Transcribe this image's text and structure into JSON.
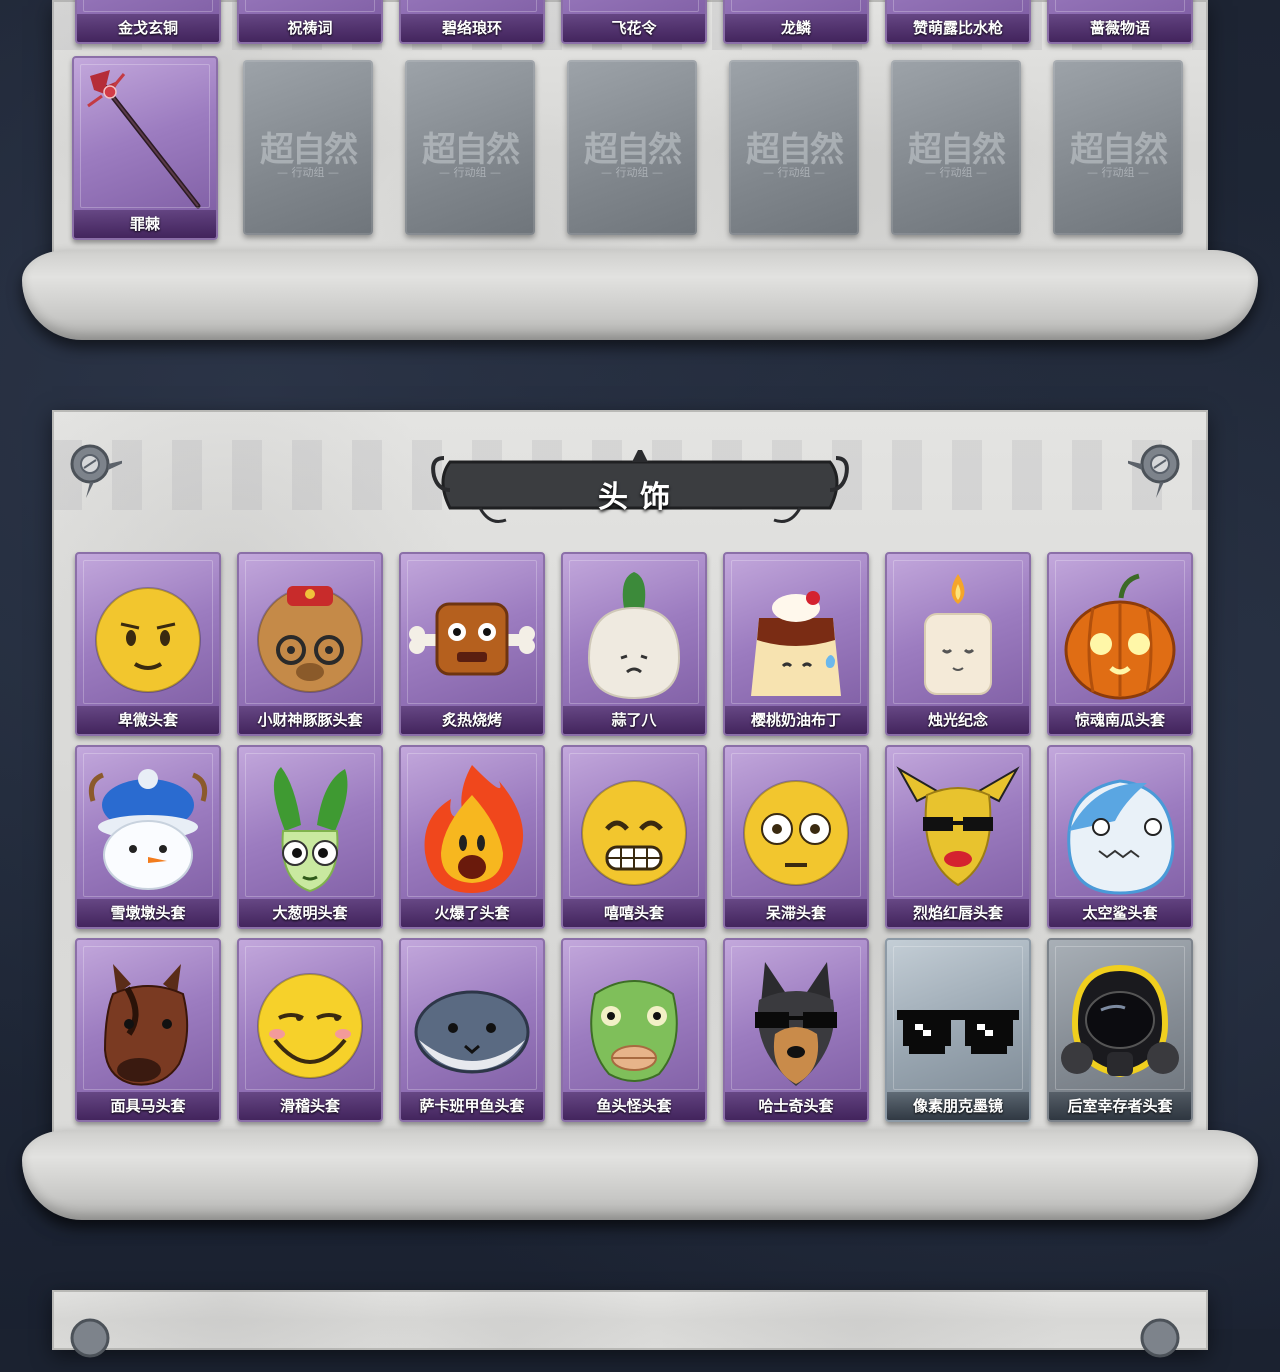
{
  "top_section": {
    "row1_labels": [
      "金戈玄铜",
      "祝祷词",
      "碧络琅环",
      "飞花令",
      "龙鳞",
      "赞萌露比水枪",
      "蔷薇物语"
    ],
    "first_item": "罪棘",
    "placeholder_logo": "超自然",
    "placeholder_sub": "行动组"
  },
  "head_section": {
    "title": "头饰",
    "items": [
      {
        "label": "卑微头套",
        "icon": "sad-smiley-head-icon",
        "rarity": "purple"
      },
      {
        "label": "小财神豚豚头套",
        "icon": "capybara-head-icon",
        "rarity": "purple"
      },
      {
        "label": "炙热烧烤",
        "icon": "meat-bone-head-icon",
        "rarity": "purple"
      },
      {
        "label": "蒜了八",
        "icon": "garlic-head-icon",
        "rarity": "purple"
      },
      {
        "label": "樱桃奶油布丁",
        "icon": "pudding-head-icon",
        "rarity": "purple"
      },
      {
        "label": "烛光纪念",
        "icon": "candle-head-icon",
        "rarity": "purple"
      },
      {
        "label": "惊魂南瓜头套",
        "icon": "pumpkin-head-icon",
        "rarity": "purple"
      },
      {
        "label": "雪墩墩头套",
        "icon": "snowman-head-icon",
        "rarity": "purple"
      },
      {
        "label": "大葱明头套",
        "icon": "scallion-head-icon",
        "rarity": "purple"
      },
      {
        "label": "火爆了头套",
        "icon": "fire-head-icon",
        "rarity": "purple"
      },
      {
        "label": "嘻嘻头套",
        "icon": "grin-smiley-head-icon",
        "rarity": "purple"
      },
      {
        "label": "呆滞头套",
        "icon": "blank-stare-head-icon",
        "rarity": "purple"
      },
      {
        "label": "烈焰红唇头套",
        "icon": "yellow-mask-head-icon",
        "rarity": "purple"
      },
      {
        "label": "太空鲨头套",
        "icon": "shark-head-icon",
        "rarity": "purple"
      },
      {
        "label": "面具马头套",
        "icon": "horse-head-icon",
        "rarity": "purple"
      },
      {
        "label": "滑稽头套",
        "icon": "funny-smiley-head-icon",
        "rarity": "purple"
      },
      {
        "label": "萨卡班甲鱼头套",
        "icon": "fish-head-icon",
        "rarity": "purple"
      },
      {
        "label": "鱼头怪头套",
        "icon": "green-fishman-head-icon",
        "rarity": "purple"
      },
      {
        "label": "哈士奇头套",
        "icon": "husky-head-icon",
        "rarity": "purple"
      },
      {
        "label": "像素朋克墨镜",
        "icon": "pixel-sunglasses-icon",
        "rarity": "blue"
      },
      {
        "label": "后室幸存者头套",
        "icon": "gas-mask-helmet-icon",
        "rarity": "gray"
      }
    ]
  },
  "colors": {
    "purple_card": "#9c7cc0",
    "gray_card": "#868d95",
    "blue_card": "#9aa7b2",
    "parchment": "#dcdcda",
    "background": "#1b2230"
  }
}
